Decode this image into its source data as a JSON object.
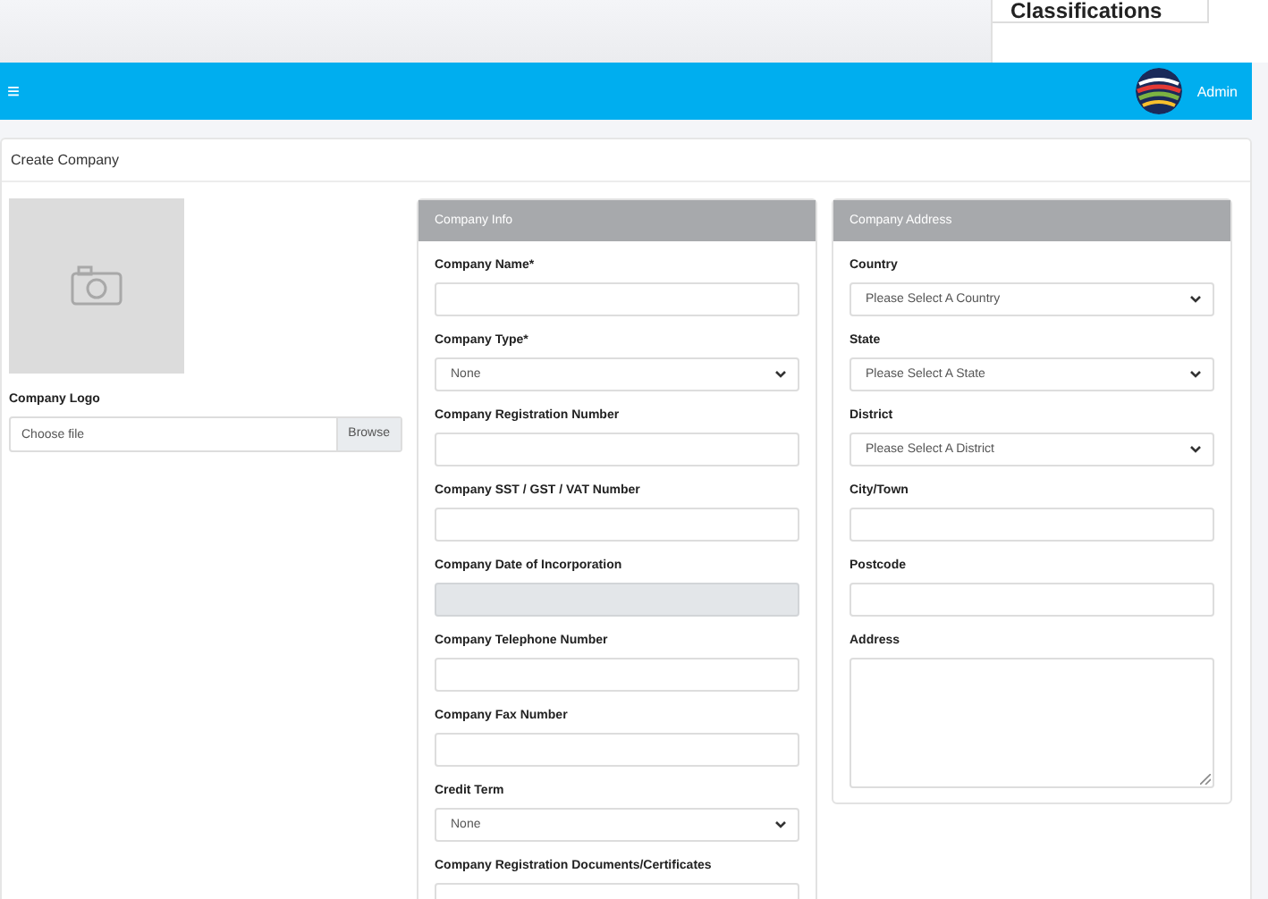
{
  "background_page": {
    "heading": "Classifications"
  },
  "header": {
    "menu_icon": "≡",
    "user": "Admin"
  },
  "card_title": "Create Company",
  "logo": {
    "label": "Company Logo",
    "file_placeholder": "Choose file",
    "browse": "Browse"
  },
  "company_info": {
    "title": "Company Info",
    "fields": [
      {
        "kind": "text",
        "label": "Company Name*",
        "disabled": false
      },
      {
        "kind": "select",
        "label": "Company Type*",
        "value": "None"
      },
      {
        "kind": "text",
        "label": "Company Registration Number",
        "disabled": false
      },
      {
        "kind": "text",
        "label": "Company SST / GST / VAT Number",
        "disabled": false
      },
      {
        "kind": "text",
        "label": "Company Date of Incorporation",
        "disabled": true
      },
      {
        "kind": "text",
        "label": "Company Telephone Number",
        "disabled": false
      },
      {
        "kind": "text",
        "label": "Company Fax Number",
        "disabled": false
      },
      {
        "kind": "select",
        "label": "Credit Term",
        "value": "None"
      },
      {
        "kind": "file",
        "label": "Company Registration Documents/Certificates"
      }
    ]
  },
  "company_address": {
    "title": "Company Address",
    "fields": [
      {
        "kind": "select",
        "label": "Country",
        "value": "Please Select A Country"
      },
      {
        "kind": "select",
        "label": "State",
        "value": "Please Select A State"
      },
      {
        "kind": "select",
        "label": "District",
        "value": "Please Select A District"
      },
      {
        "kind": "text",
        "label": "City/Town",
        "disabled": false
      },
      {
        "kind": "text",
        "label": "Postcode",
        "disabled": false
      },
      {
        "kind": "textarea",
        "label": "Address"
      }
    ]
  }
}
